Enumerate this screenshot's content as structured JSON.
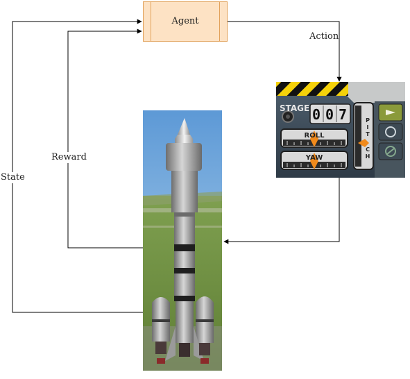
{
  "agent": {
    "label": "Agent"
  },
  "edges": {
    "action": "Action",
    "reward": "Reward",
    "state": "State"
  },
  "control_panel": {
    "stage_label": "STAGE",
    "stage_digits": [
      "0",
      "0",
      "7"
    ],
    "roll_label": "ROLL",
    "yaw_label": "YAW",
    "pitch_letters": [
      "P",
      "I",
      "T",
      "C",
      "H"
    ]
  },
  "colors": {
    "agent_fill": "#fde2c4",
    "agent_border": "#e1a15a",
    "panel_body": "#3a4a58",
    "hazard_yellow": "#f5d20a",
    "needle_orange": "#f08a1c",
    "sky": "#7fb3de",
    "grass": "#6e8e3f"
  },
  "icons": [
    "rocket-engine-icon",
    "parachute-icon",
    "decoupler-icon"
  ]
}
